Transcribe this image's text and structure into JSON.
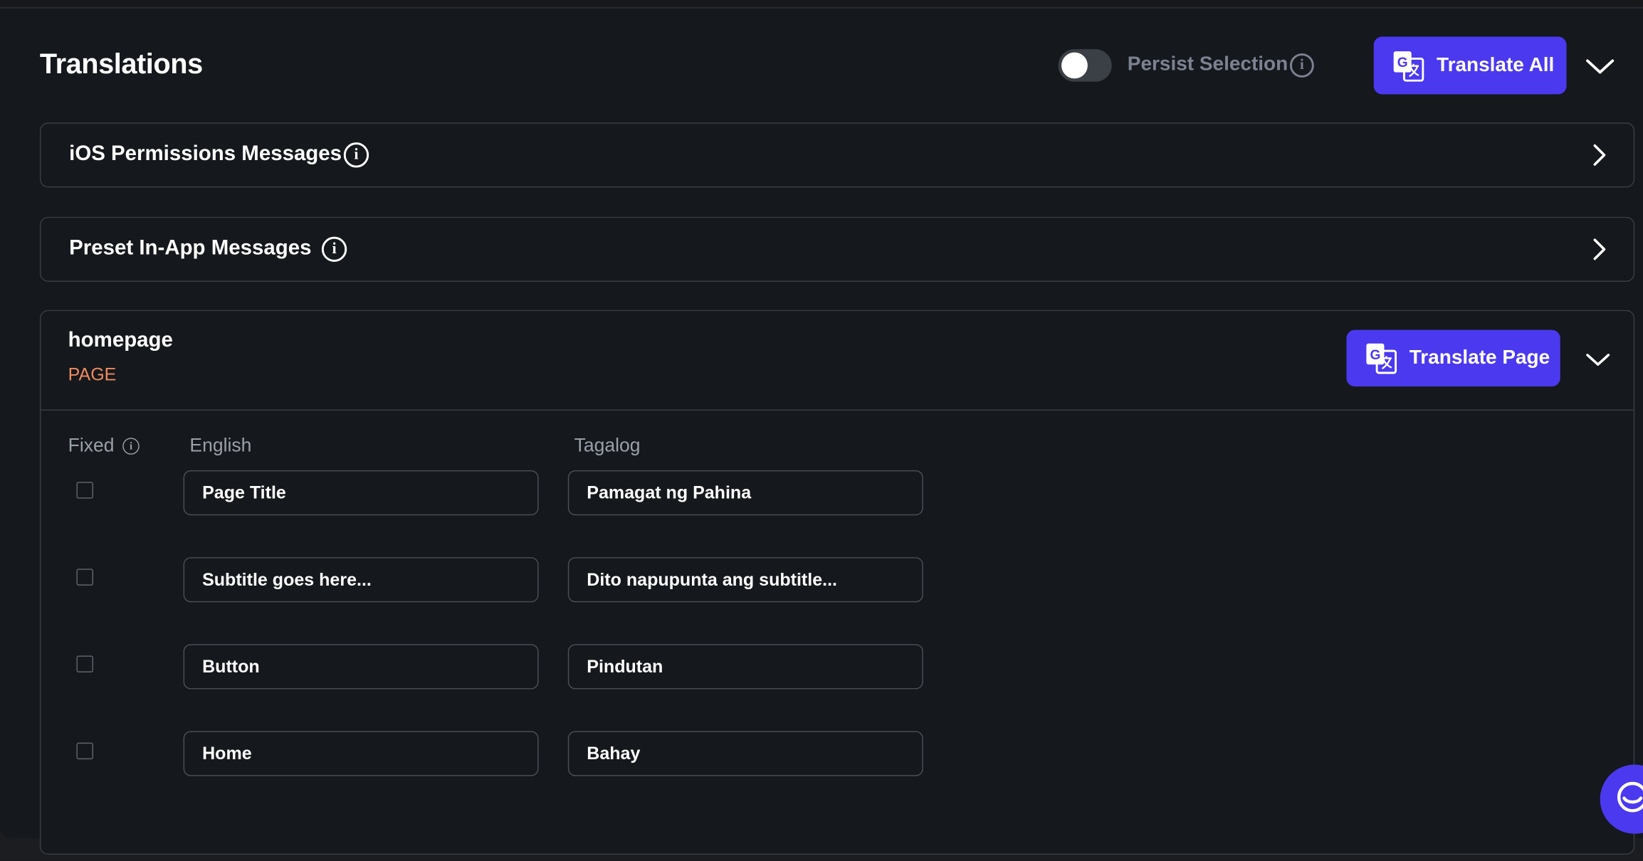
{
  "header": {
    "title": "Translations",
    "persist_label": "Persist Selection",
    "persist_enabled": false,
    "translate_all_label": "Translate All"
  },
  "sections": [
    {
      "label": "iOS Permissions Messages"
    },
    {
      "label": "Preset In-App Messages"
    }
  ],
  "page": {
    "name": "homepage",
    "type": "PAGE",
    "translate_label": "Translate Page",
    "columns": {
      "fixed": "Fixed",
      "source": "English",
      "target": "Tagalog"
    },
    "rows": [
      {
        "fixed": false,
        "source": "Page Title",
        "target": "Pamagat ng Pahina"
      },
      {
        "fixed": false,
        "source": "Subtitle goes here...",
        "target": "Dito napupunta ang subtitle..."
      },
      {
        "fixed": false,
        "source": "Button",
        "target": "Pindutan"
      },
      {
        "fixed": false,
        "source": "Home",
        "target": "Bahay"
      }
    ]
  },
  "colors": {
    "accent": "#4b39ef",
    "page_type": "#ee8b60",
    "background": "#15181c"
  },
  "icons": {
    "translate": "translate-icon",
    "info": "info-icon",
    "chevron_right": "chevron-right-icon",
    "chevron_down": "chevron-down-icon",
    "chat": "chat-icon"
  }
}
